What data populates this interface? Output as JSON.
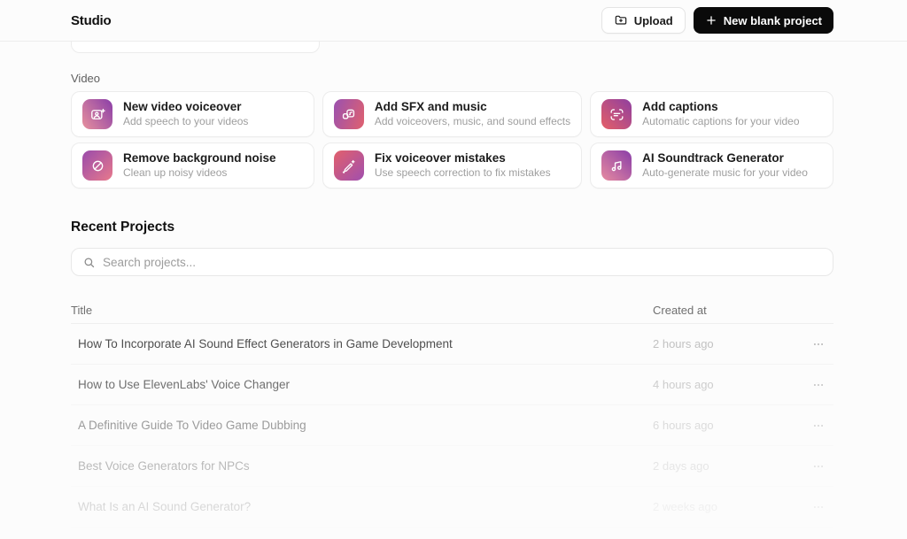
{
  "header": {
    "title": "Studio",
    "upload_label": "Upload",
    "new_project_label": "New blank project",
    "primary_button_color": "#0a0a0a"
  },
  "video_section": {
    "label": "Video",
    "cards": [
      {
        "title": "New video voiceover",
        "subtitle": "Add speech to your videos",
        "icon_name": "video-voiceover-icon",
        "icon_ref": "#sym-video-voiceover",
        "icon_gradient": {
          "angle": "55deg",
          "from": "#e8919d",
          "to": "#8a3ea8"
        }
      },
      {
        "title": "Add SFX and music",
        "subtitle": "Add voiceovers, music, and sound effects",
        "icon_name": "sfx-music-icon",
        "icon_ref": "#sym-sfx-music",
        "icon_gradient": {
          "angle": "110deg",
          "from": "#9a51b0",
          "to": "#e0616e"
        }
      },
      {
        "title": "Add captions",
        "subtitle": "Automatic captions for your video",
        "icon_name": "captions-icon",
        "icon_ref": "#sym-captions",
        "icon_gradient": {
          "angle": "225deg",
          "from": "#8f3fa0",
          "to": "#e55f67"
        }
      },
      {
        "title": "Remove background noise",
        "subtitle": "Clean up noisy videos",
        "icon_name": "noise-removal-icon",
        "icon_ref": "#sym-noise-removal",
        "icon_gradient": {
          "angle": "135deg",
          "from": "#9a4bab",
          "to": "#e7798c"
        }
      },
      {
        "title": "Fix voiceover mistakes",
        "subtitle": "Use speech correction to fix mistakes",
        "icon_name": "voiceover-fix-icon",
        "icon_ref": "#sym-voiceover-fix",
        "icon_gradient": {
          "angle": "135deg",
          "from": "#e2606c",
          "to": "#a04fae"
        }
      },
      {
        "title": "AI Soundtrack Generator",
        "subtitle": "Auto-generate music for your video",
        "icon_name": "soundtrack-icon",
        "icon_ref": "#sym-soundtrack",
        "icon_gradient": {
          "angle": "45deg",
          "from": "#e78ba0",
          "to": "#8a3ea8"
        }
      }
    ]
  },
  "recent_projects": {
    "heading": "Recent Projects",
    "search_placeholder": "Search projects...",
    "table": {
      "columns": [
        "Title",
        "Created at"
      ],
      "rows": [
        {
          "title": "How To Incorporate AI Sound Effect Generators in Game Development",
          "created_at": "2 hours ago"
        },
        {
          "title": "How to Use ElevenLabs' Voice Changer",
          "created_at": "4 hours ago"
        },
        {
          "title": "A Definitive Guide To Video Game Dubbing",
          "created_at": "6 hours ago"
        },
        {
          "title": "Best Voice Generators for NPCs",
          "created_at": "2 days ago"
        },
        {
          "title": "What Is an AI Sound Generator?",
          "created_at": "2 weeks ago"
        }
      ]
    }
  }
}
